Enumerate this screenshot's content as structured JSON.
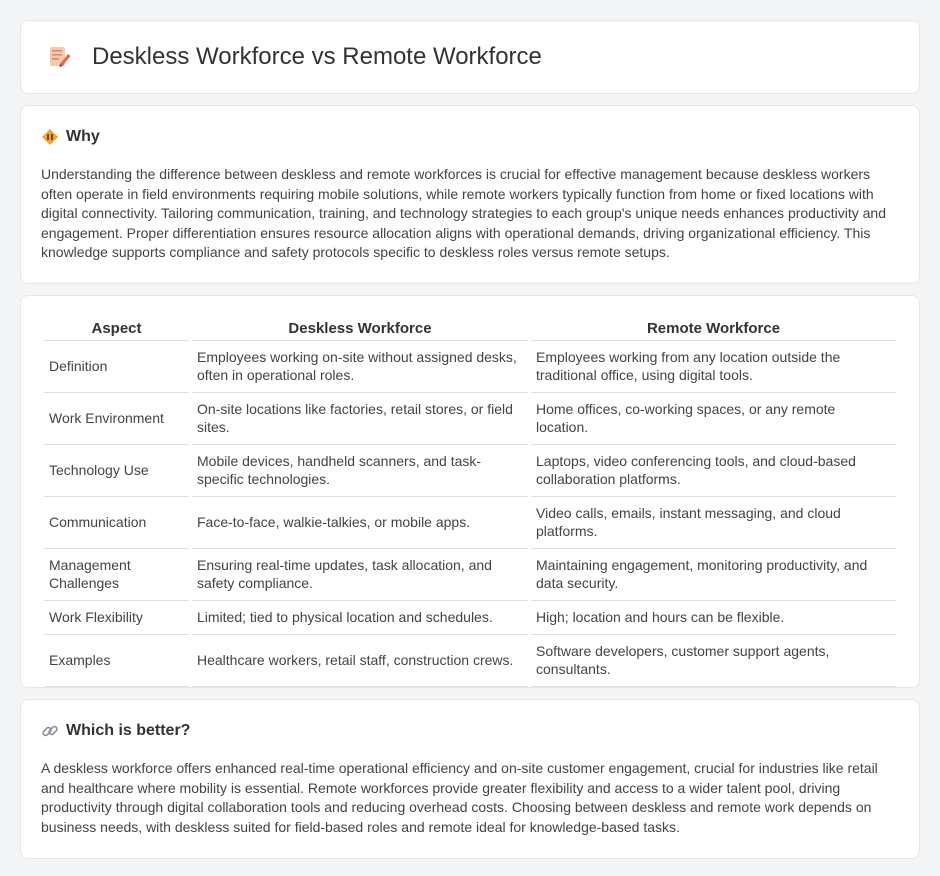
{
  "header": {
    "title": "Deskless Workforce vs Remote Workforce",
    "icon": "document-pen-icon"
  },
  "why": {
    "title": "Why",
    "icon": "diamond-warning-icon",
    "text": "Understanding the difference between deskless and remote workforces is crucial for effective management because deskless workers often operate in field environments requiring mobile solutions, while remote workers typically function from home or fixed locations with digital connectivity. Tailoring communication, training, and technology strategies to each group's unique needs enhances productivity and engagement. Proper differentiation ensures resource allocation aligns with operational demands, driving organizational efficiency. This knowledge supports compliance and safety protocols specific to deskless roles versus remote setups."
  },
  "table": {
    "headers": [
      "Aspect",
      "Deskless Workforce",
      "Remote Workforce"
    ],
    "rows": [
      [
        "Definition",
        "Employees working on-site without assigned desks, often in operational roles.",
        "Employees working from any location outside the traditional office, using digital tools."
      ],
      [
        "Work Environment",
        "On-site locations like factories, retail stores, or field sites.",
        "Home offices, co-working spaces, or any remote location."
      ],
      [
        "Technology Use",
        "Mobile devices, handheld scanners, and task-specific technologies.",
        "Laptops, video conferencing tools, and cloud-based collaboration platforms."
      ],
      [
        "Communication",
        "Face-to-face, walkie-talkies, or mobile apps.",
        "Video calls, emails, instant messaging, and cloud platforms."
      ],
      [
        "Management Challenges",
        "Ensuring real-time updates, task allocation, and safety compliance.",
        "Maintaining engagement, monitoring productivity, and data security."
      ],
      [
        "Work Flexibility",
        "Limited; tied to physical location and schedules.",
        "High; location and hours can be flexible."
      ],
      [
        "Examples",
        "Healthcare workers, retail staff, construction crews.",
        "Software developers, customer support agents, consultants."
      ]
    ]
  },
  "better": {
    "title": "Which is better?",
    "icon": "link-icon",
    "text": "A deskless workforce offers enhanced real-time operational efficiency and on-site customer engagement, crucial for industries like retail and healthcare where mobility is essential. Remote workforces provide greater flexibility and access to a wider talent pool, driving productivity through digital collaboration tools and reducing overhead costs. Choosing between deskless and remote work depends on business needs, with deskless suited for field-based roles and remote ideal for knowledge-based tasks."
  }
}
